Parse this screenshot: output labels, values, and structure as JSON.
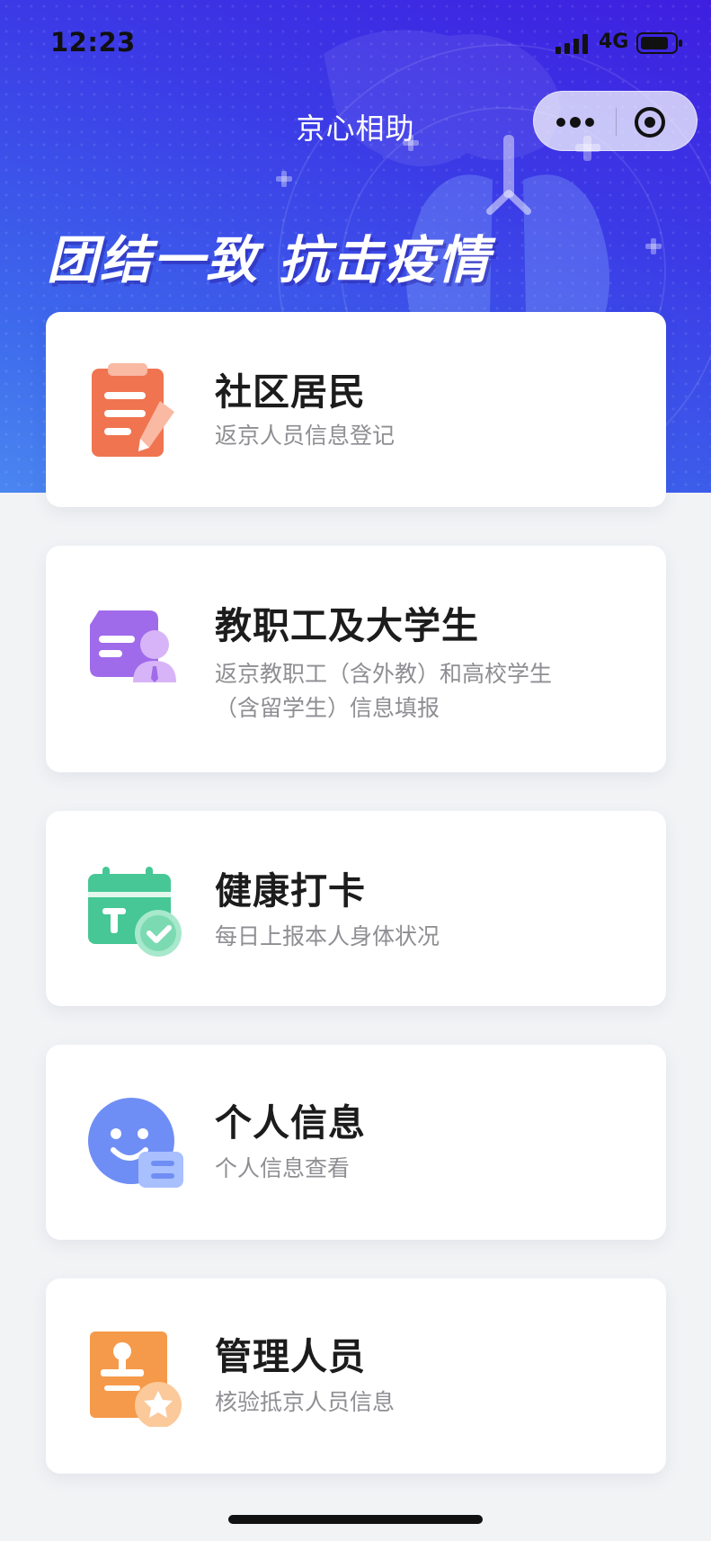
{
  "status_bar": {
    "time": "12:23",
    "network": "4G"
  },
  "nav": {
    "title": "京心相助",
    "more_icon": "more-dots-icon",
    "close_icon": "target-close-icon"
  },
  "banner": {
    "slogan": "团结一致 抗击疫情",
    "gradient_colors": [
      "#3e1fe0",
      "#3d67ec",
      "#4a86f0"
    ]
  },
  "cards": [
    {
      "title": "社区居民",
      "desc": "返京人员信息登记",
      "icon": "clipboard-pen-icon",
      "color": "#f07450"
    },
    {
      "title": "教职工及大学生",
      "desc_line1": "返京教职工（含外教）和高校学生",
      "desc_line2": "（含留学生）信息填报",
      "icon": "id-card-person-icon",
      "color": "#a06bea"
    },
    {
      "title": "健康打卡",
      "desc": "每日上报本人身体状况",
      "icon": "calendar-check-icon",
      "color": "#46c795"
    },
    {
      "title": "个人信息",
      "desc": "个人信息查看",
      "icon": "smiley-face-icon",
      "color": "#6f8ef5"
    },
    {
      "title": "管理人员",
      "desc": "核验抵京人员信息",
      "icon": "stamp-star-icon",
      "color": "#f59a4a"
    }
  ]
}
